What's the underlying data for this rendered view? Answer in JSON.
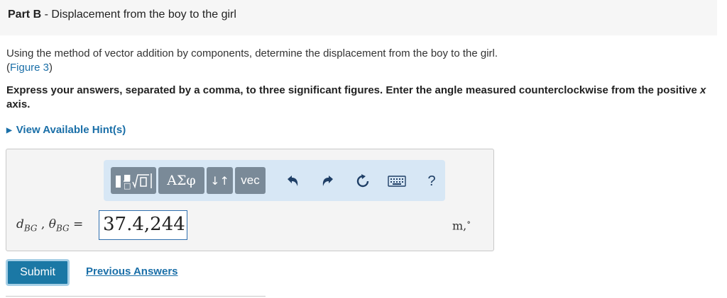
{
  "header": {
    "part_label": "Part B",
    "separator": " - ",
    "title": "Displacement from the boy to the girl"
  },
  "question": {
    "text": "Using the method of vector addition by components, determine the displacement from the boy to the girl.",
    "figure_link_open": "(",
    "figure_link": "Figure 3",
    "figure_link_close": ")",
    "instructions_part1": "Express your answers, separated by a comma, to three significant figures. Enter the angle measured counterclockwise from the positive ",
    "instructions_var": "x",
    "instructions_part2": " axis."
  },
  "hints": {
    "label": "View Available Hint(s)",
    "icon": "triangle-right-icon"
  },
  "toolbar": {
    "templates_icon": "templates-icon",
    "greek_label": "ΑΣφ",
    "arrows_label": "↓↑",
    "vec_label": "vec",
    "undo_icon": "undo-icon",
    "redo_icon": "redo-icon",
    "reset_icon": "reset-icon",
    "keyboard_icon": "keyboard-icon",
    "help_label": "?"
  },
  "answer": {
    "d_var": "d",
    "d_sub": "BG",
    "comma": " , ",
    "theta_var": "θ",
    "theta_sub": "BG",
    "equals": " = ",
    "value": "37.4,244",
    "unit_m": "m,",
    "unit_deg": "∘"
  },
  "actions": {
    "submit_label": "Submit",
    "previous_answers_label": "Previous Answers"
  },
  "colors": {
    "link": "#1a6fa8",
    "toolbar_bg": "#d7e7f5",
    "toolbar_button": "#7a8a98",
    "submit_bg": "#1b78a5"
  }
}
